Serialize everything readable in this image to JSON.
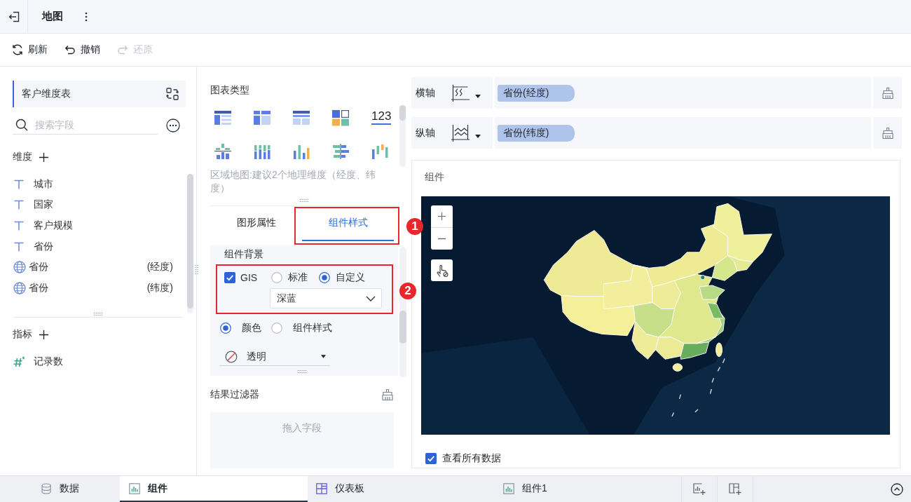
{
  "header": {
    "title": "地图"
  },
  "toolbar": [
    {
      "kind": "refresh",
      "label": "刷新",
      "disabled": false
    },
    {
      "kind": "undo",
      "label": "撤销",
      "disabled": false
    },
    {
      "kind": "redo",
      "label": "还原",
      "disabled": true
    }
  ],
  "data_panel": {
    "table": "客户维度表",
    "search": {
      "placeholder": "搜索字段"
    },
    "dimensions": {
      "title": "维度",
      "fields": [
        {
          "kind": "text",
          "name": "城市"
        },
        {
          "kind": "text",
          "name": "国家"
        },
        {
          "kind": "text",
          "name": "客户规模"
        },
        {
          "kind": "text",
          "name": "省份"
        },
        {
          "kind": "geo",
          "name": "省份",
          "role": "(经度)"
        },
        {
          "kind": "geo",
          "name": "省份",
          "role": "(纬度)"
        }
      ]
    },
    "measures": {
      "title": "指标",
      "fields": [
        {
          "kind": "number",
          "name": "记录数"
        }
      ]
    }
  },
  "chart_type": {
    "title": "图表类型",
    "kpi_label": "123",
    "hint": "区域地图:建议2个地理维度（经度、纬度）"
  },
  "style_panel": {
    "tabs": [
      {
        "label": "图形属性",
        "selected": false
      },
      {
        "label": "组件样式",
        "selected": true
      }
    ],
    "section_title": "组件背景",
    "gis": {
      "label": "GIS",
      "checked": true
    },
    "map_style": [
      {
        "label": "标准",
        "selected": false
      },
      {
        "label": "自定义",
        "selected": true
      }
    ],
    "map_theme": {
      "value": "深蓝"
    },
    "background_mode": [
      {
        "label": "颜色",
        "selected": true
      },
      {
        "label": "组件样式",
        "selected": false
      }
    ],
    "background_color": {
      "value": "透明"
    }
  },
  "filter": {
    "title": "结果过滤器",
    "drop_hint": "拖入字段"
  },
  "axes": [
    {
      "kind": "horizontal",
      "label": "横轴",
      "field": "省份(经度)"
    },
    {
      "kind": "vertical",
      "label": "纵轴",
      "field": "省份(纬度)"
    }
  ],
  "component": {
    "title": "组件",
    "show_all": {
      "label": "查看所有数据",
      "checked": true
    }
  },
  "annotations": [
    {
      "label": "1"
    },
    {
      "label": "2"
    }
  ],
  "bottom_tabs": [
    {
      "kind": "data",
      "label": "数据",
      "selected": false
    },
    {
      "kind": "chart",
      "label": "组件",
      "selected": true
    },
    {
      "kind": "dashboard",
      "label": "仪表板",
      "selected": false
    },
    {
      "kind": "chart",
      "label": "组件1",
      "selected": false
    }
  ]
}
